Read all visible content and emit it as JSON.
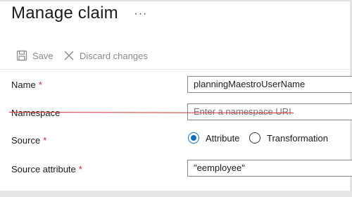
{
  "header": {
    "title": "Manage claim",
    "more_label": "···"
  },
  "toolbar": {
    "save_label": "Save",
    "save_icon": "save-icon",
    "discard_label": "Discard changes",
    "discard_icon": "close-icon"
  },
  "form": {
    "name": {
      "label": "Name",
      "required_mark": "*",
      "value": "planningMaestroUserName"
    },
    "namespace": {
      "label": "Namespace",
      "placeholder": "Enter a namespace URI"
    },
    "source": {
      "label": "Source",
      "required_mark": "*",
      "options": [
        {
          "label": "Attribute",
          "selected": true
        },
        {
          "label": "Transformation",
          "selected": false
        }
      ]
    },
    "source_attribute": {
      "label": "Source attribute",
      "required_mark": "*",
      "value": "\"eemployee\""
    }
  },
  "colors": {
    "accent": "#0f6cbd",
    "required": "#c4262e",
    "strike_annotation": "#d13438"
  }
}
